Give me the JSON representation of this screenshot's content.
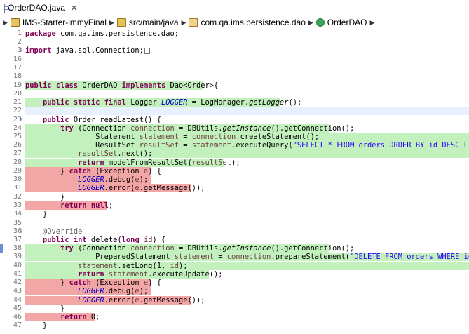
{
  "tab": {
    "title": "OrderDAO.java",
    "close": "✕"
  },
  "breadcrumb": {
    "items": [
      {
        "label": "IMS-Starter-immyFinal",
        "icon": "project-icon"
      },
      {
        "label": "src/main/java",
        "icon": "source-folder-icon"
      },
      {
        "label": "com.qa.ims.persistence.dao",
        "icon": "package-icon"
      },
      {
        "label": "OrderDAO",
        "icon": "class-icon"
      }
    ]
  },
  "editor": {
    "lines": [
      {
        "num": "1",
        "text": "package com.qa.ims.persistence.dao;"
      },
      {
        "num": "2",
        "text": ""
      },
      {
        "num": "3",
        "text": "import java.sql.Connection;"
      },
      {
        "num": "16",
        "text": ""
      },
      {
        "num": "17",
        "text": ""
      },
      {
        "num": "18",
        "text": ""
      },
      {
        "num": "19",
        "text": "public class OrderDAO implements Dao<Order>{"
      },
      {
        "num": "20",
        "text": ""
      },
      {
        "num": "21",
        "text": "    public static final Logger LOGGER = LogManager.getLogger();"
      },
      {
        "num": "22",
        "text": ""
      },
      {
        "num": "23",
        "text": "    public Order readLatest() {"
      },
      {
        "num": "24",
        "text": "        try (Connection connection = DBUtils.getInstance().getConnection();"
      },
      {
        "num": "25",
        "text": "                Statement statement = connection.createStatement();"
      },
      {
        "num": "26",
        "text": "                ResultSet resultSet = statement.executeQuery(\"SELECT * FROM orders ORDER BY id DESC LIMIT"
      },
      {
        "num": "27",
        "text": "            resultSet.next();"
      },
      {
        "num": "28",
        "text": "            return modelFromResultSet(resultSet);"
      },
      {
        "num": "29",
        "text": "        } catch (Exception e) {"
      },
      {
        "num": "30",
        "text": "            LOGGER.debug(e);"
      },
      {
        "num": "31",
        "text": "            LOGGER.error(e.getMessage());"
      },
      {
        "num": "32",
        "text": "        }"
      },
      {
        "num": "33",
        "text": "        return null;"
      },
      {
        "num": "34",
        "text": "    }"
      },
      {
        "num": "35",
        "text": ""
      },
      {
        "num": "36",
        "text": "    @Override"
      },
      {
        "num": "37",
        "text": "    public int delete(long id) {"
      },
      {
        "num": "38",
        "text": "        try (Connection connection = DBUtils.getInstance().getConnection();"
      },
      {
        "num": "39",
        "text": "                PreparedStatement statement = connection.prepareStatement(\"DELETE FROM orders WHERE id ="
      },
      {
        "num": "40",
        "text": "            statement.setLong(1, id);"
      },
      {
        "num": "41",
        "text": "            return statement.executeUpdate();"
      },
      {
        "num": "42",
        "text": "        } catch (Exception e) {"
      },
      {
        "num": "43",
        "text": "            LOGGER.debug(e);"
      },
      {
        "num": "44",
        "text": "            LOGGER.error(e.getMessage());"
      },
      {
        "num": "45",
        "text": "        }"
      },
      {
        "num": "46",
        "text": "        return 0;"
      },
      {
        "num": "47",
        "text": "    }"
      }
    ]
  },
  "colors": {
    "covered": "#c2f1bd",
    "missed": "#f3a6a6",
    "keyword": "#7f0055",
    "field": "#0000c0",
    "string": "#2a00ff",
    "local_var": "#6a3e3e"
  }
}
